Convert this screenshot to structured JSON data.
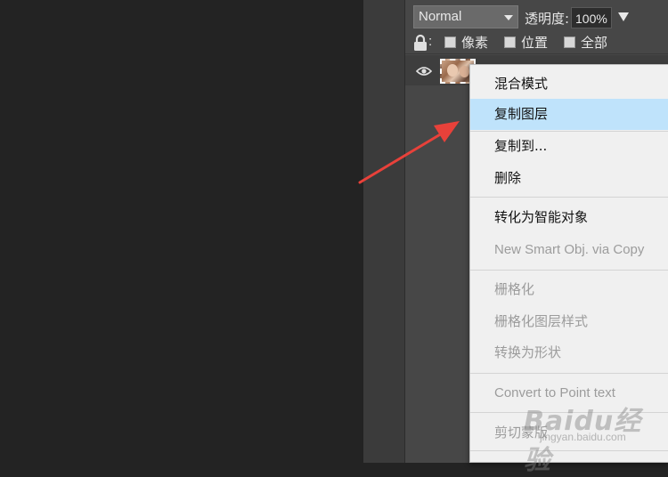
{
  "layers_panel": {
    "blend_mode": "Normal",
    "opacity_label": "透明度:",
    "opacity_value": "100%",
    "lock_colon": ":",
    "lock_options": [
      "像素",
      "位置",
      "全部"
    ]
  },
  "context_menu": {
    "items": [
      {
        "label": "混合模式",
        "state": "normal"
      },
      {
        "label": "复制图层",
        "state": "highlighted"
      },
      {
        "label": "复制到...",
        "state": "normal"
      },
      {
        "label": "删除",
        "state": "normal"
      },
      {
        "label": "转化为智能对象",
        "state": "normal"
      },
      {
        "label": "New Smart Obj. via Copy",
        "state": "disabled"
      },
      {
        "label": "栅格化",
        "state": "disabled"
      },
      {
        "label": "栅格化图层样式",
        "state": "disabled"
      },
      {
        "label": "转换为形状",
        "state": "disabled"
      },
      {
        "label": "Convert to Point text",
        "state": "disabled"
      },
      {
        "label": "剪切蒙版",
        "state": "disabled"
      }
    ]
  },
  "watermark": {
    "brand": "Baidu经验",
    "url": "jingyan.baidu.com"
  },
  "colors": {
    "menu_highlight": "#bfe3fb",
    "arrow": "#e8413a",
    "panel_bg": "#474747",
    "canvas_bg": "#232323"
  }
}
